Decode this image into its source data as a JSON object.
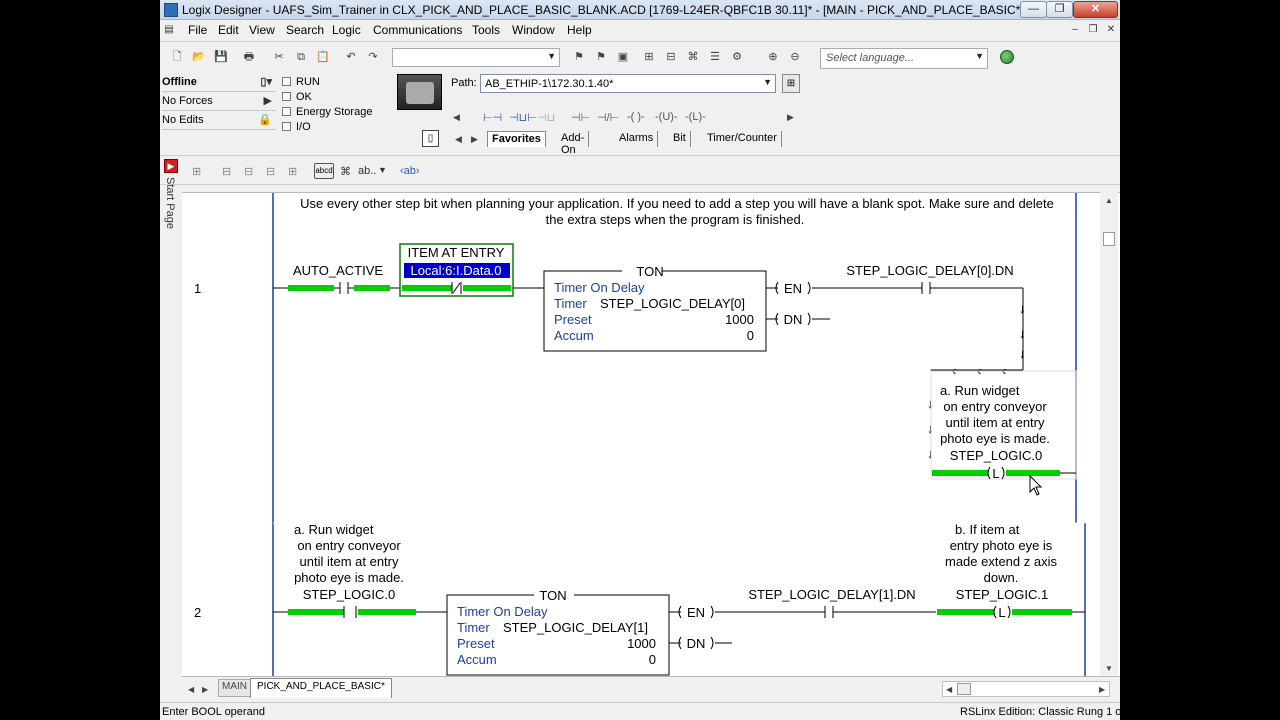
{
  "window": {
    "title": "Logix Designer - UAFS_Sim_Trainer in CLX_PICK_AND_PLACE_BASIC_BLANK.ACD [1769-L24ER-QBFC1B 30.11]* - [MAIN - PICK_AND_PLACE_BASIC*]",
    "min_glyph": "—",
    "max_glyph": "❐",
    "close_glyph": "✕"
  },
  "menu": [
    "File",
    "Edit",
    "View",
    "Search",
    "Logic",
    "Communications",
    "Tools",
    "Window",
    "Help"
  ],
  "mdi_controls": [
    "–",
    "❐",
    "✕"
  ],
  "toolbar": {
    "language_placeholder": "Select language..."
  },
  "status_panel": {
    "mode": "Offline",
    "forces": "No Forces",
    "edits": "No Edits",
    "checks": [
      "RUN",
      "OK",
      "Energy Storage",
      "I/O"
    ]
  },
  "path": {
    "label": "Path:",
    "value": "AB_ETHIP-1\\172.30.1.40*"
  },
  "palette": {
    "instructions": [
      "⊣⊢",
      "⊣/⊢",
      "-( )-",
      "-(U)-",
      "-(L)-"
    ],
    "tabs": [
      "Favorites",
      "Add-On",
      "Alarms",
      "Bit",
      "Timer/Counter"
    ]
  },
  "start_page": "Start Page",
  "ladder": {
    "comment": [
      "Use every other step bit when planning your application.  If you need to add a step you will have a blank spot.  Make sure and delete",
      "the extra steps when the program is finished."
    ],
    "rung1": {
      "number": "1",
      "contact1": "AUTO_ACTIVE",
      "contact2_desc": "ITEM AT ENTRY",
      "contact2_tag": "Local:6:I.Data.0",
      "ton_header": "TON",
      "ton_title": "Timer On Delay",
      "ton_timer_label": "Timer",
      "ton_timer": "STEP_LOGIC_DELAY[0]",
      "ton_preset_label": "Preset",
      "ton_preset": "1000",
      "ton_accum_label": "Accum",
      "ton_accum": "0",
      "en": "EN",
      "dn": "DN",
      "dn_contact": "STEP_LOGIC_DELAY[0].DN",
      "latch_desc": [
        "a.        Run widget",
        "on entry conveyor",
        "until item at entry",
        "photo eye is made."
      ],
      "latch_tag": "STEP_LOGIC.0",
      "latch_symbol": "L"
    },
    "rung2": {
      "number": "2",
      "contact1_desc": [
        "a.        Run widget",
        "on entry conveyor",
        "until item at entry",
        "photo eye is made."
      ],
      "contact1": "STEP_LOGIC.0",
      "ton_header": "TON",
      "ton_title": "Timer On Delay",
      "ton_timer_label": "Timer",
      "ton_timer": "STEP_LOGIC_DELAY[1]",
      "ton_preset_label": "Preset",
      "ton_preset": "1000",
      "ton_accum_label": "Accum",
      "ton_accum": "0",
      "en": "EN",
      "dn": "DN",
      "dn_contact": "STEP_LOGIC_DELAY[1].DN",
      "latch_desc": [
        "b.        If item at",
        "entry photo eye is",
        "made extend z axis",
        "down."
      ],
      "latch_tag": "STEP_LOGIC.1",
      "latch_symbol": "L"
    }
  },
  "tabs": {
    "main": "MAIN",
    "routine": "PICK_AND_PLACE_BASIC*"
  },
  "statusbar": {
    "left": "Enter BOOL operand",
    "right": "RSLinx Edition: Classic   Rung 1 o"
  },
  "colors": {
    "highlight": "#00d000",
    "selection": "#0000cc",
    "title_gradient_top": "#dbe6f3"
  }
}
